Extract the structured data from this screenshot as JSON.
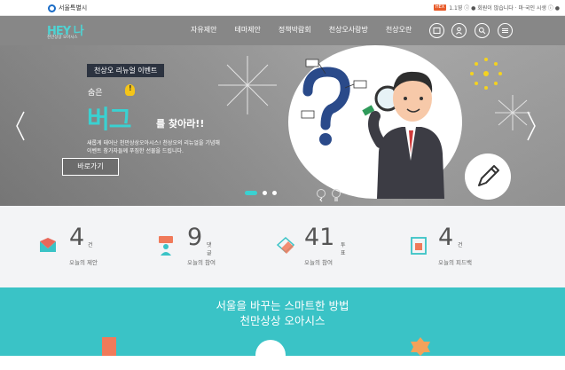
{
  "topbar": {
    "city_name": "서울특별시",
    "badge": "HEX",
    "util_text": "1.1영 ⓘ ● 회원이 많습니다 · 마·국인 시생 ⓘ ● "
  },
  "header": {
    "logo_text": "HEY 나",
    "logo_sub": "천만상상 오아시스",
    "menu": [
      "자유제안",
      "테마제안",
      "정책박람회",
      "천상오사랑방",
      "천상오란"
    ]
  },
  "hero": {
    "event_tag": "천상오 리뉴얼 이벤트",
    "shout": "숨은",
    "headline_big": "버그",
    "headline_rest": "를 찾아라!!",
    "desc_line1": "새롭게 태어난 천만상상오아시스! 천상오의 리뉴얼을 기념해",
    "desc_line2": "이벤트 참가자들께 푸짐한 선물을 드립니다.",
    "more_label": "바로가기",
    "slide_count": 3,
    "active_slide": 1
  },
  "stats": [
    {
      "icon": "proposal-icon",
      "value": "4",
      "unit": "건",
      "label": "오늘의 제안"
    },
    {
      "icon": "participant-icon",
      "value": "9",
      "unit": "댓글",
      "label": "오늘의 참여"
    },
    {
      "icon": "vote-icon",
      "value": "41",
      "unit": "투표",
      "label": "오늘의 참여"
    },
    {
      "icon": "feedback-icon",
      "value": "4",
      "unit": "건",
      "label": "오늘의 피드백"
    }
  ],
  "promo": {
    "line1": "서울을 바꾸는 스마트한 방법",
    "line2": "천만상상 오아시스"
  },
  "colors": {
    "accent": "#3ad1d1",
    "promo_bg": "#3ac3c6",
    "nav_bg": "#878787",
    "stats_bg": "#f3f4f6"
  }
}
